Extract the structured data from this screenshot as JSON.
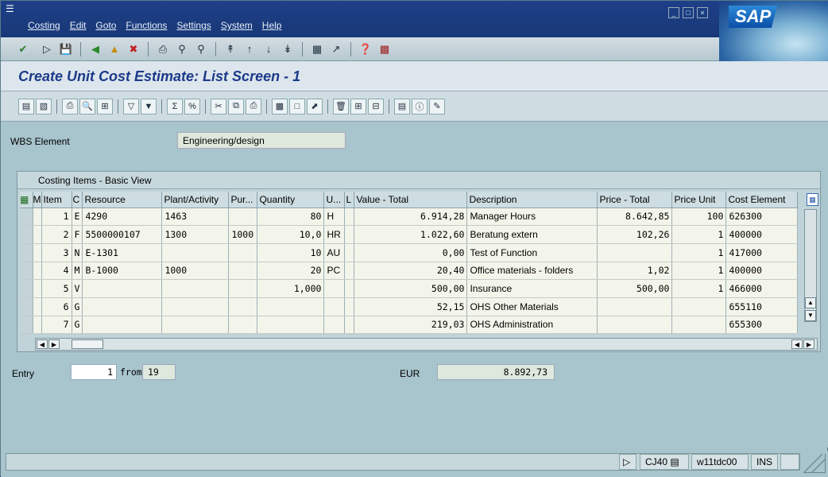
{
  "menubar": {
    "items": [
      "Costing",
      "Edit",
      "Goto",
      "Functions",
      "Settings",
      "System",
      "Help"
    ]
  },
  "brand": {
    "logo": "SAP"
  },
  "page": {
    "title": "Create Unit Cost Estimate: List Screen - 1"
  },
  "wbs": {
    "label": "WBS Element",
    "value": "Engineering/design"
  },
  "table": {
    "caption": "Costing Items - Basic View",
    "headers": [
      "M",
      "Item",
      "C",
      "Resource",
      "Plant/Activity",
      "Pur...",
      "Quantity",
      "U...",
      "L",
      "Value - Total",
      "Description",
      "Price - Total",
      "Price Unit",
      "Cost Element"
    ],
    "rows": [
      {
        "item": "1",
        "cat": "E",
        "resource": "4290",
        "plant": "1463",
        "pur": "",
        "qty": "80",
        "unit": "H",
        "value": "6.914,28",
        "desc": "Manager Hours",
        "price": "8.642,85",
        "price_unit": "100",
        "cost_elem": "626300"
      },
      {
        "item": "2",
        "cat": "F",
        "resource": "5500000107",
        "plant": "1300",
        "pur": "1000",
        "qty": "10,0",
        "unit": "HR",
        "value": "1.022,60",
        "desc": "Beratung extern",
        "price": "102,26",
        "price_unit": "1",
        "cost_elem": "400000"
      },
      {
        "item": "3",
        "cat": "N",
        "resource": "E-1301",
        "plant": "",
        "pur": "",
        "qty": "10",
        "unit": "AU",
        "value": "0,00",
        "desc": "Test of Function",
        "price": "",
        "price_unit": "1",
        "cost_elem": "417000"
      },
      {
        "item": "4",
        "cat": "M",
        "resource": "B-1000",
        "plant": "1000",
        "pur": "",
        "qty": "20",
        "unit": "PC",
        "value": "20,40",
        "desc": "Office materials - folders",
        "price": "1,02",
        "price_unit": "1",
        "cost_elem": "400000"
      },
      {
        "item": "5",
        "cat": "V",
        "resource": "",
        "plant": "",
        "pur": "",
        "qty": "1,000",
        "unit": "",
        "value": "500,00",
        "desc": "Insurance",
        "price": "500,00",
        "price_unit": "1",
        "cost_elem": "466000"
      },
      {
        "item": "6",
        "cat": "G",
        "resource": "",
        "plant": "",
        "pur": "",
        "qty": "",
        "unit": "",
        "value": "52,15",
        "desc": "OHS Other Materials",
        "price": "",
        "price_unit": "",
        "cost_elem": "655110"
      },
      {
        "item": "7",
        "cat": "G",
        "resource": "",
        "plant": "",
        "pur": "",
        "qty": "",
        "unit": "",
        "value": "219,03",
        "desc": "OHS Administration",
        "price": "",
        "price_unit": "",
        "cost_elem": "655300"
      }
    ]
  },
  "entry": {
    "label": "Entry",
    "current": "1",
    "from_label": "from",
    "total": "19"
  },
  "currency": {
    "label": "EUR",
    "total": "8.892,73"
  },
  "status": {
    "transaction": "CJ40",
    "server": "w11tdc00",
    "mode": "INS"
  }
}
